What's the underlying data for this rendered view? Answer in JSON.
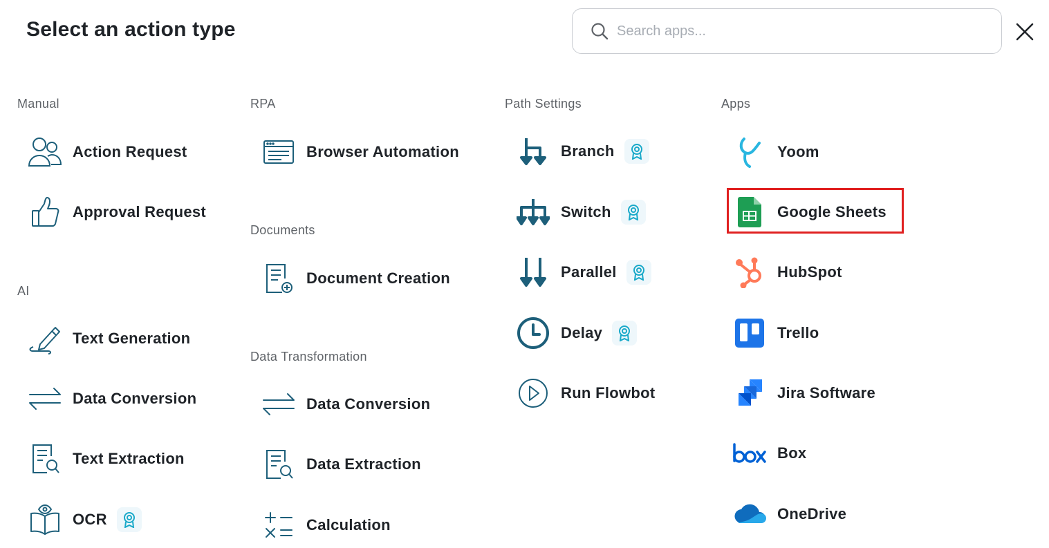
{
  "header": {
    "title": "Select an action type",
    "search_placeholder": "Search apps..."
  },
  "sections": {
    "manual": {
      "title": "Manual",
      "items": [
        "Action Request",
        "Approval Request"
      ]
    },
    "ai": {
      "title": "AI",
      "items": [
        "Text Generation",
        "Data Conversion",
        "Text Extraction",
        "OCR"
      ]
    },
    "rpa": {
      "title": "RPA",
      "items": [
        "Browser Automation"
      ]
    },
    "documents": {
      "title": "Documents",
      "items": [
        "Document Creation"
      ]
    },
    "data_transformation": {
      "title": "Data Transformation",
      "items": [
        "Data Conversion",
        "Data Extraction",
        "Calculation"
      ]
    },
    "path_settings": {
      "title": "Path Settings",
      "items": [
        "Branch",
        "Switch",
        "Parallel",
        "Delay",
        "Run Flowbot"
      ]
    },
    "apps": {
      "title": "Apps",
      "items": [
        "Yoom",
        "Google Sheets",
        "HubSpot",
        "Trello",
        "Jira Software",
        "Box",
        "OneDrive"
      ]
    }
  },
  "colors": {
    "icon_teal": "#1d5f7a",
    "badge_cyan": "#19a9c9",
    "highlight_red": "#e02020",
    "sheets_green": "#1e9e54",
    "hubspot_orange": "#ff7a59",
    "trello_blue": "#1d74e8",
    "jira_blue": "#2684ff",
    "box_blue": "#0061d5",
    "onedrive_blue": "#0f6cbd"
  },
  "premium_badge_icon": "award-badge-icon"
}
